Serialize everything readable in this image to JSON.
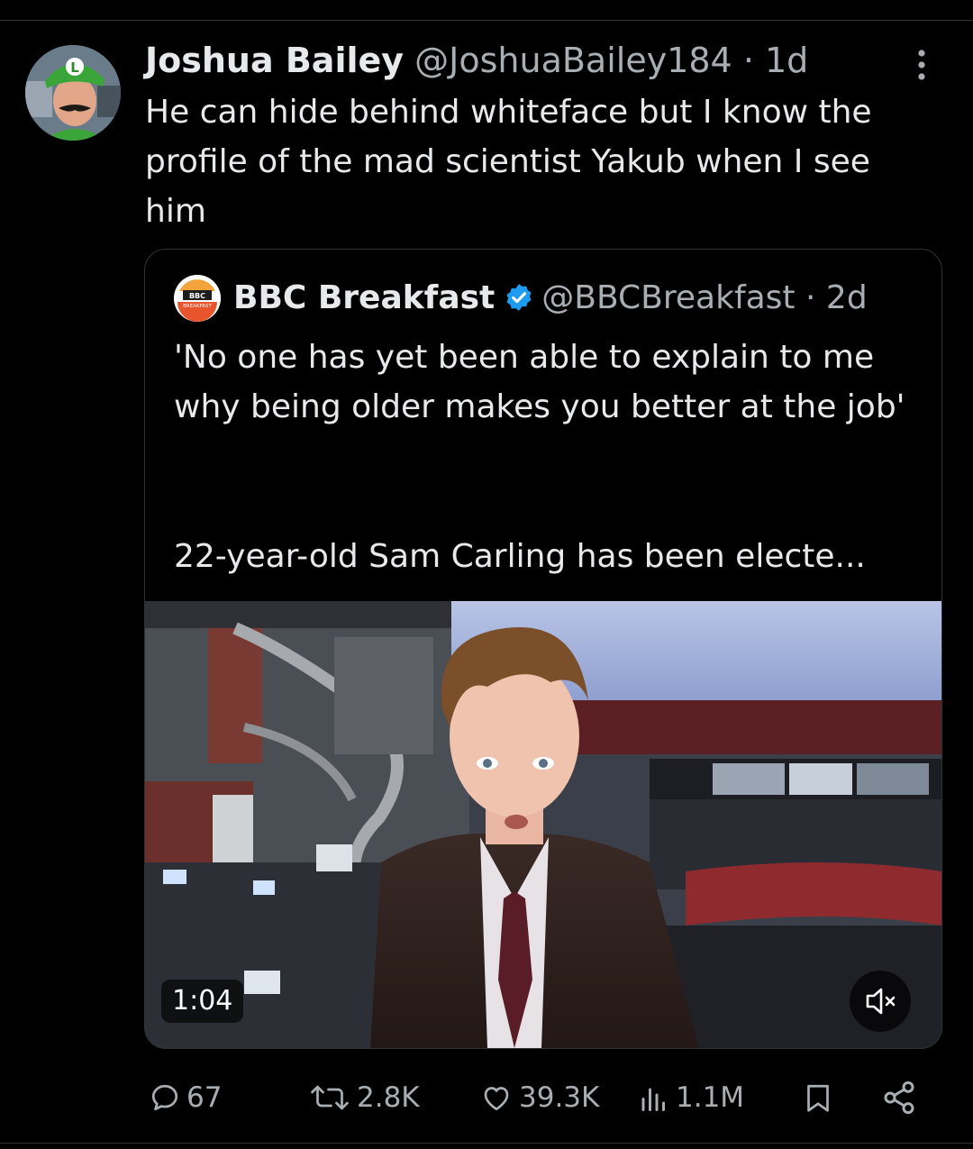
{
  "tweet": {
    "author_name": "Joshua Bailey",
    "author_handle": "@JoshuaBailey184",
    "separator": "·",
    "time": "1d",
    "text": "He can hide behind whiteface but I know the profile of the mad scientist Yakub when I see him",
    "avatar_cap_letter": "L"
  },
  "quoted": {
    "author_name": "BBC Breakfast",
    "author_handle": "@BBCBreakfast",
    "separator": "·",
    "time": "2d",
    "avatar_text_top": "BBC",
    "avatar_text_bottom": "BREAKFAST",
    "text_line1": "'No one has yet been able to explain to me why being older makes you better at the job'",
    "text_line2": "22-year-old Sam Carling has been electe...",
    "video_duration": "1:04"
  },
  "actions": {
    "replies": "67",
    "reposts": "2.8K",
    "likes": "39.3K",
    "views": "1.1M"
  },
  "colors": {
    "background": "#000000",
    "text_primary": "#e7e9ea",
    "text_secondary": "#a9aeb3",
    "border": "#2f3336",
    "verified": "#1d9bf0"
  }
}
